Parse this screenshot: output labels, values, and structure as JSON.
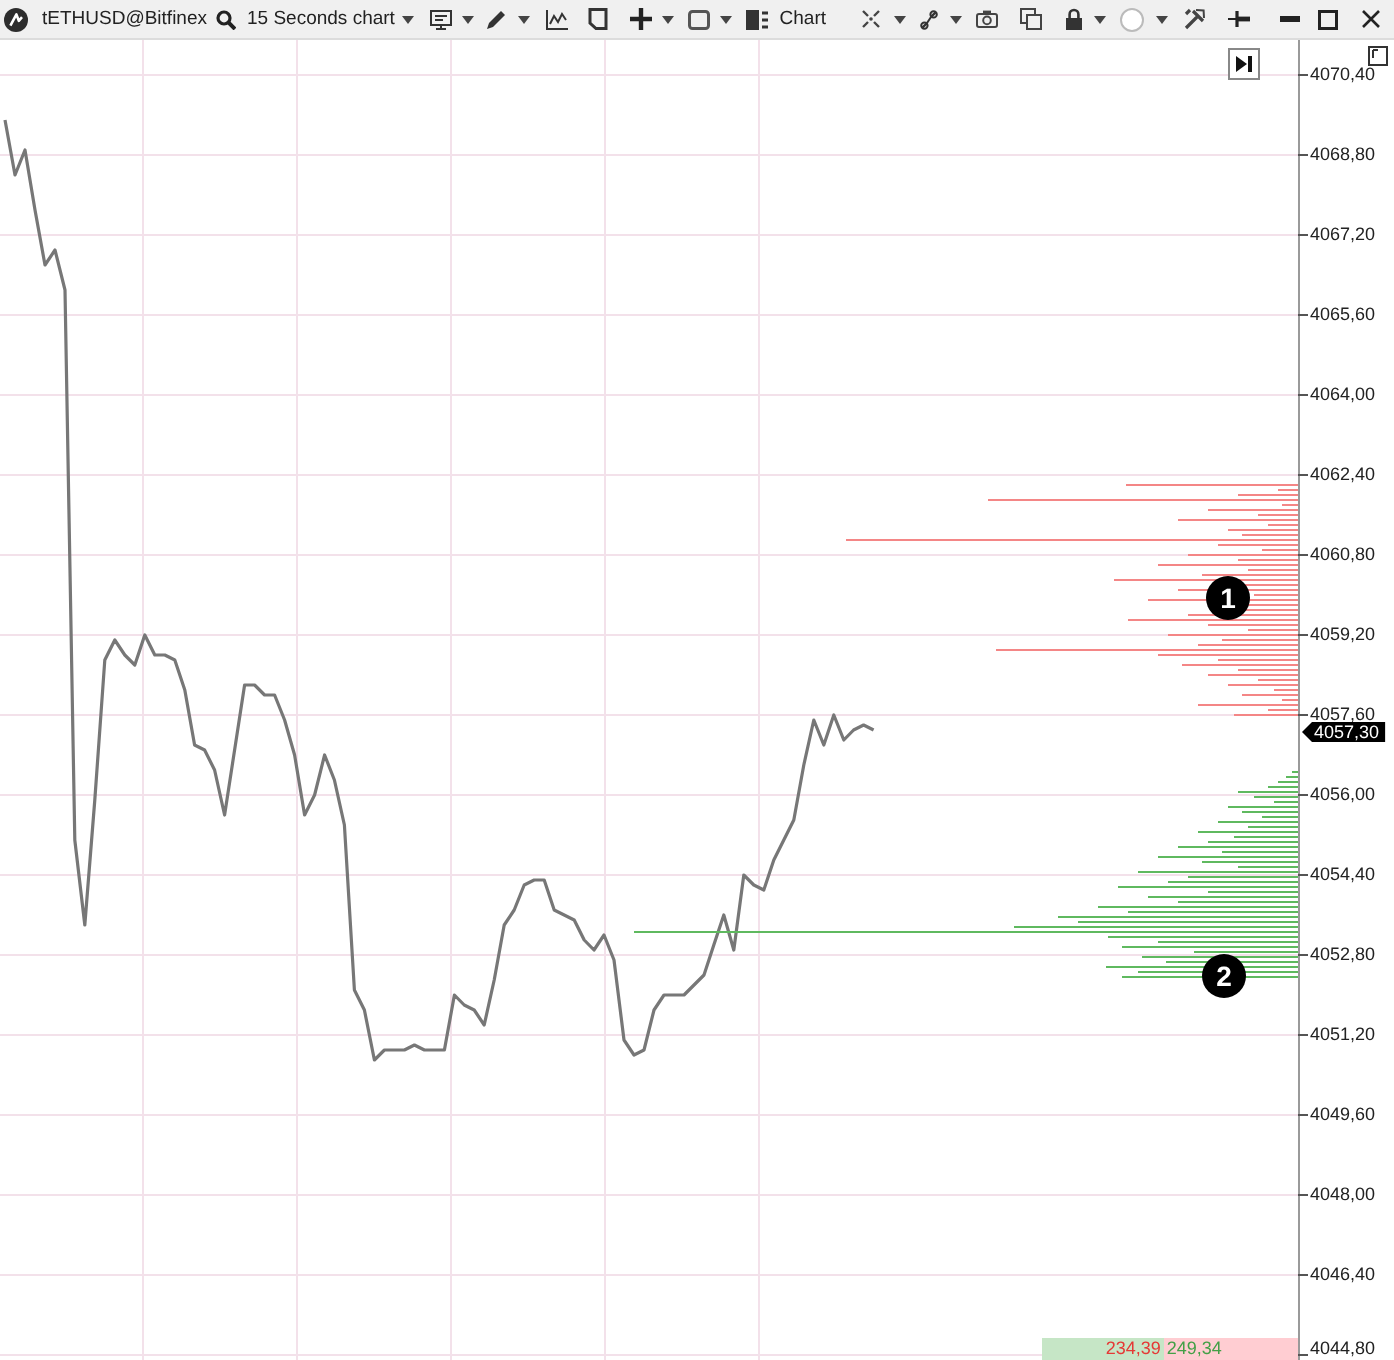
{
  "toolbar": {
    "symbol": "tETHUSD@Bitfinex",
    "timeframe": "15 Seconds chart",
    "chart_title": "Chart"
  },
  "chart": {
    "chart_data": {
      "type": "line",
      "grid": true,
      "ylim": [
        4044.7,
        4071.1
      ],
      "yticks": [
        {
          "value": 4070.4,
          "label": "4070,40"
        },
        {
          "value": 4068.8,
          "label": "4068,80"
        },
        {
          "value": 4067.2,
          "label": "4067,20"
        },
        {
          "value": 4065.6,
          "label": "4065,60"
        },
        {
          "value": 4064.0,
          "label": "4064,00"
        },
        {
          "value": 4062.4,
          "label": "4062,40"
        },
        {
          "value": 4060.8,
          "label": "4060,80"
        },
        {
          "value": 4059.2,
          "label": "4059,20"
        },
        {
          "value": 4057.6,
          "label": "4057,60"
        },
        {
          "value": 4056.0,
          "label": "4056,00"
        },
        {
          "value": 4054.4,
          "label": "4054,40"
        },
        {
          "value": 4052.8,
          "label": "4052,80"
        },
        {
          "value": 4051.2,
          "label": "4051,20"
        },
        {
          "value": 4049.6,
          "label": "4049,60"
        },
        {
          "value": 4048.0,
          "label": "4048,00"
        },
        {
          "value": 4046.4,
          "label": "4046,40"
        },
        {
          "value": 4044.8,
          "label": "4044,80"
        }
      ],
      "series": [
        {
          "color": "#777777",
          "values": [
            4069.5,
            4068.4,
            4068.9,
            4067.7,
            4066.6,
            4066.9,
            4066.1,
            4055.1,
            4053.4,
            4055.9,
            4058.7,
            4059.1,
            4058.8,
            4058.6,
            4059.2,
            4058.8,
            4058.8,
            4058.7,
            4058.1,
            4057.0,
            4056.9,
            4056.5,
            4055.6,
            4056.9,
            4058.2,
            4058.2,
            4058.0,
            4058.0,
            4057.5,
            4056.8,
            4055.6,
            4056.0,
            4056.8,
            4056.3,
            4055.4,
            4052.1,
            4051.7,
            4050.7,
            4050.9,
            4050.9,
            4050.9,
            4051.0,
            4050.9,
            4050.9,
            4050.9,
            4052.0,
            4051.8,
            4051.7,
            4051.4,
            4052.3,
            4053.4,
            4053.7,
            4054.2,
            4054.3,
            4054.3,
            4053.7,
            4053.6,
            4053.5,
            4053.1,
            4052.9,
            4053.2,
            4052.7,
            4051.1,
            4050.8,
            4050.9,
            4051.7,
            4052.0,
            4052.0,
            4052.0,
            4052.2,
            4052.4,
            4053.0,
            4053.6,
            4052.9,
            4054.4,
            4054.2,
            4054.1,
            4054.7,
            4055.1,
            4055.5,
            4056.6,
            4057.5,
            4057.0,
            4057.6,
            4057.1,
            4057.3,
            4057.4,
            4057.3,
            null,
            null,
            null,
            null,
            null,
            null,
            null,
            null,
            null,
            null,
            null,
            null,
            null,
            null,
            null,
            null,
            null,
            null,
            null,
            null,
            null,
            null,
            null,
            null,
            null,
            null,
            null,
            null,
            null,
            null,
            null,
            null,
            null,
            null,
            null,
            null,
            null,
            null,
            null,
            null,
            null,
            null
          ]
        }
      ],
      "annotations": [
        "1",
        "2"
      ]
    },
    "last_price": {
      "text": "4057,30"
    }
  },
  "volume_totals": [
    {
      "kind": "bid",
      "text": "234,39",
      "level": 0.48
    },
    {
      "kind": "ask",
      "text": "249,34",
      "level": 0.52
    }
  ]
}
